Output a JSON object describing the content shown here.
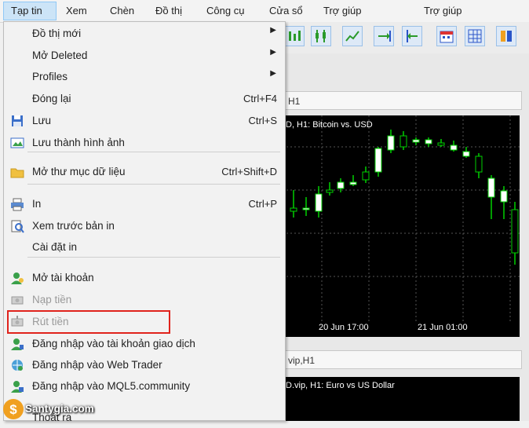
{
  "menubar": {
    "items": [
      "Tạp tin",
      "Xem",
      "Chèn",
      "Đồ thị",
      "Công cụ",
      "Cửa sổ",
      "Trợ giúp",
      "Trợ giúp"
    ]
  },
  "file_menu": {
    "items": [
      {
        "label": "Đồ thị mới",
        "shortcut": "",
        "submenu": true,
        "icon": ""
      },
      {
        "label": "Mở Deleted",
        "shortcut": "",
        "submenu": true,
        "icon": ""
      },
      {
        "label": "Profiles",
        "shortcut": "",
        "submenu": true,
        "icon": ""
      },
      {
        "label": "Đóng lại",
        "shortcut": "Ctrl+F4",
        "submenu": false,
        "icon": ""
      },
      {
        "label": "Lưu",
        "shortcut": "Ctrl+S",
        "submenu": false,
        "icon": "save-icon"
      },
      {
        "label": "Lưu thành hình ảnh",
        "shortcut": "",
        "submenu": false,
        "icon": "save-image-icon"
      },
      {
        "label": "Mở thư mục dữ liệu",
        "shortcut": "Ctrl+Shift+D",
        "submenu": false,
        "icon": "folder-icon"
      },
      {
        "label": "In",
        "shortcut": "Ctrl+P",
        "submenu": false,
        "icon": "printer-icon"
      },
      {
        "label": "Xem trước bản in",
        "shortcut": "",
        "submenu": false,
        "icon": "print-preview-icon"
      },
      {
        "label": "Cài đặt in",
        "shortcut": "",
        "submenu": false,
        "icon": ""
      },
      {
        "label": "Mở tài khoản",
        "shortcut": "",
        "submenu": false,
        "icon": "open-account-icon"
      },
      {
        "label": "Nạp tiền",
        "shortcut": "",
        "submenu": false,
        "icon": "deposit-icon",
        "disabled": true
      },
      {
        "label": "Rút tiền",
        "shortcut": "",
        "submenu": false,
        "icon": "withdraw-icon",
        "disabled": true
      },
      {
        "label": "Đăng nhập vào tài khoản giao dịch",
        "shortcut": "",
        "submenu": false,
        "icon": "login-account-icon"
      },
      {
        "label": "Đăng nhập vào Web Trader",
        "shortcut": "",
        "submenu": false,
        "icon": "web-trader-icon"
      },
      {
        "label": "Đăng nhập vào MQL5.community",
        "shortcut": "",
        "submenu": false,
        "icon": "mql5-icon"
      },
      {
        "label": "Thoát ra",
        "shortcut": "",
        "submenu": false,
        "icon": ""
      }
    ]
  },
  "chart_windows": {
    "window1_title": "H1",
    "window1_label": "D, H1:  Bitcoin vs. USD",
    "window1_time_labels": [
      "20 Jun 17:00",
      "21 Jun 01:00"
    ],
    "window2_title": "vip,H1",
    "window2_label": "D.vip, H1:  Euro vs US Dollar"
  },
  "watermark": {
    "text": "Santygia.com"
  },
  "colors": {
    "highlight": "#e0231c",
    "menu_active": "#cce4f7",
    "candle_up": "#ffffff",
    "candle_wick": "#00d000"
  }
}
